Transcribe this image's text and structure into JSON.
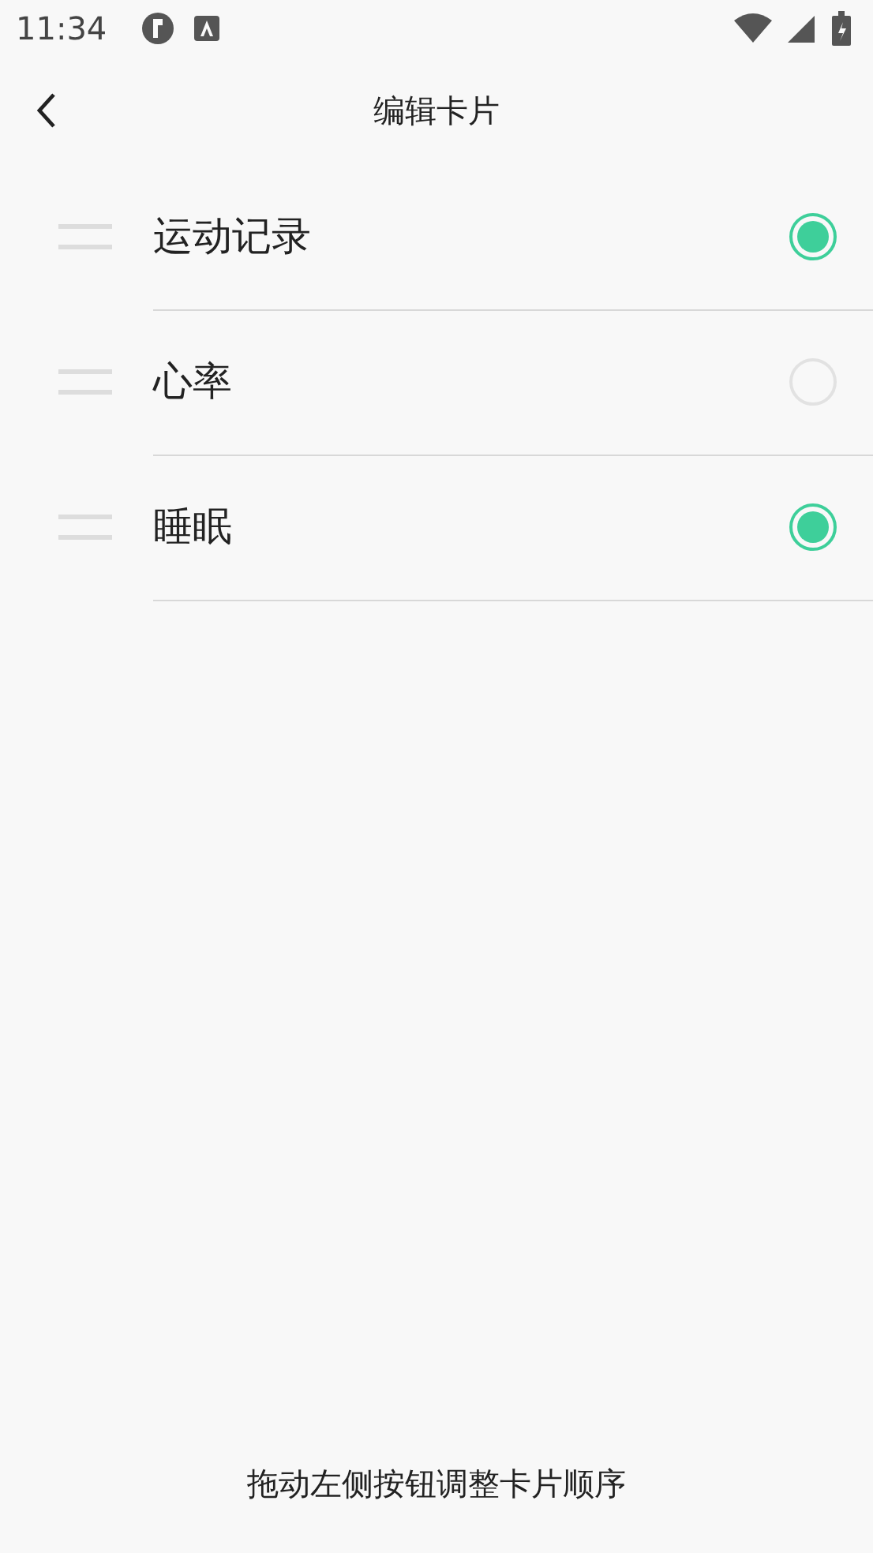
{
  "status_bar": {
    "time": "11:34"
  },
  "header": {
    "title": "编辑卡片"
  },
  "cards": [
    {
      "label": "运动记录",
      "selected": true
    },
    {
      "label": "心率",
      "selected": false
    },
    {
      "label": "睡眠",
      "selected": true
    }
  ],
  "footer": {
    "hint": "拖动左侧按钮调整卡片顺序"
  }
}
